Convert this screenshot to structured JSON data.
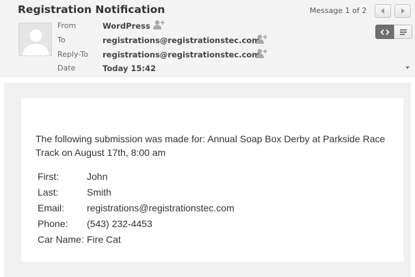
{
  "header": {
    "subject": "Registration Notification",
    "message_counter": "Message 1 of 2",
    "fields": [
      {
        "label": "From",
        "value": "WordPress"
      },
      {
        "label": "To",
        "value": "registrations@registrationstec.com"
      },
      {
        "label": "Reply-To",
        "value": "registrations@registrationstec.com"
      },
      {
        "label": "Date",
        "value": "Today 15:42"
      }
    ]
  },
  "colors": {
    "header_bg": "#f4f4f4",
    "active_toggle": "#6f6f6f",
    "body_bg": "#f0f0f0"
  },
  "icons": {
    "prev": "chevron-left-icon",
    "next": "chevron-right-icon",
    "add_contact": "add-contact-icon",
    "html_view": "code-icon",
    "plain_view": "lines-icon",
    "expand": "caret-down-icon"
  },
  "message": {
    "intro": "The following submission was made for: Annual Soap Box Derby at Parkside Race Track on August 17th, 8:00 am",
    "details": [
      {
        "key": "First:",
        "value": "John"
      },
      {
        "key": "Last:",
        "value": "Smith"
      },
      {
        "key": "Email:",
        "value": "registrations@registrationstec.com"
      },
      {
        "key": "Phone:",
        "value": "(543) 232-4453"
      },
      {
        "key": "Car Name:",
        "value": "Fire Cat"
      }
    ]
  }
}
